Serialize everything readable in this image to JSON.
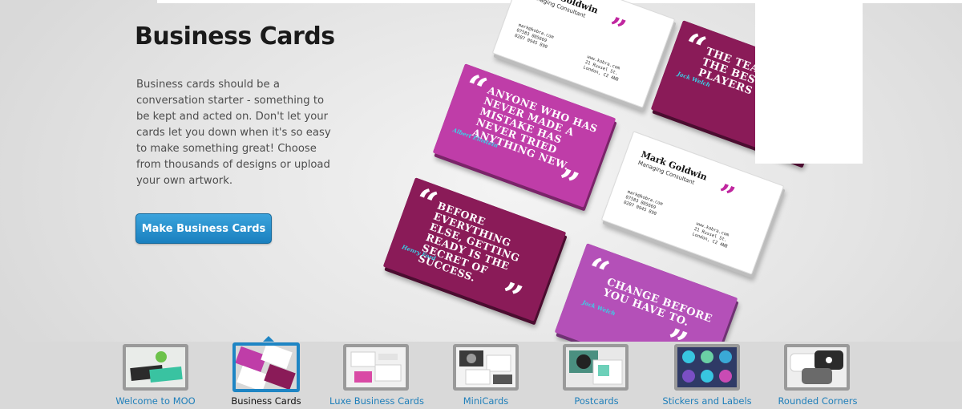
{
  "hero": {
    "title": "Business Cards",
    "description": "Business cards should be a conversation starter - something to be kept and acted on. Don't let your cards let you down when it's so easy to make something great! Choose from thousands of designs or upload your own artwork.",
    "cta_label": "Make Business Cards"
  },
  "cards": {
    "quote_open": "“",
    "quote_close": "”",
    "white_top": {
      "name": "Mark Goldwin",
      "role": "Managing Consultant",
      "email": "mark@kobra.com",
      "phone1": "07583 805669",
      "phone2": "0207 0945 890",
      "web": "www.kobra.com",
      "street": "21 Russel St.",
      "city": "London, C2 4NB"
    },
    "white_mid": {
      "name": "Mark Goldwin",
      "role": "Managing Consultant",
      "email": "mark@kobra.com",
      "phone1": "07583 805669",
      "phone2": "0207 0945 890",
      "web": "www.kobra.com",
      "street": "21 Russel St.",
      "city": "London, C2 4NB"
    },
    "einstein": {
      "quote": "Anyone who has never made a mistake has never tried anything new.",
      "author": "Albert Einstein"
    },
    "ford": {
      "quote": "Before everything else, getting ready is the secret of success.",
      "author": "Henry Ford"
    },
    "welch_top": {
      "quote": "The team with the best players wins.",
      "author": "Jack Welch"
    },
    "welch_bottom": {
      "quote": "Change before you have to.",
      "author": "Jack Welch"
    }
  },
  "nav": {
    "items": [
      {
        "label": "Welcome to MOO",
        "active": false
      },
      {
        "label": "Business Cards",
        "active": true
      },
      {
        "label": "Luxe Business Cards",
        "active": false
      },
      {
        "label": "MiniCards",
        "active": false
      },
      {
        "label": "Postcards",
        "active": false
      },
      {
        "label": "Stickers and Labels",
        "active": false
      },
      {
        "label": "Rounded Corners",
        "active": false
      }
    ]
  },
  "colors": {
    "accent_blue": "#1e85c4",
    "card_pink": "#bf3da8",
    "card_plum": "#8a1b58",
    "card_violet": "#b450b8",
    "author_cyan": "#39d2e8"
  }
}
